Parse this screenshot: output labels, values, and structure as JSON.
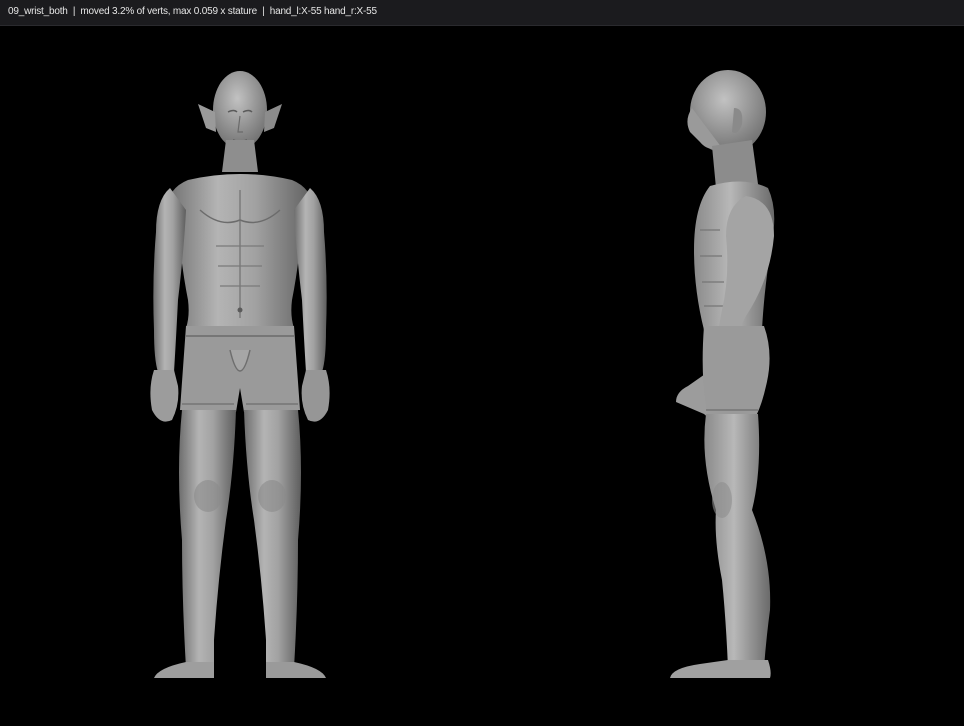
{
  "header": {
    "name": "09_wrist_both",
    "separator": "|",
    "moved": "moved 3.2% of verts, max 0.059 x stature",
    "hands": "hand_l:X-55 hand_r:X-55"
  },
  "views": [
    {
      "name": "front-view"
    },
    {
      "name": "side-view"
    }
  ],
  "colors": {
    "background": "#000000",
    "header_bg": "#1b1b1e",
    "header_text": "#e6e6e6",
    "mesh": "#a8a8a8"
  }
}
